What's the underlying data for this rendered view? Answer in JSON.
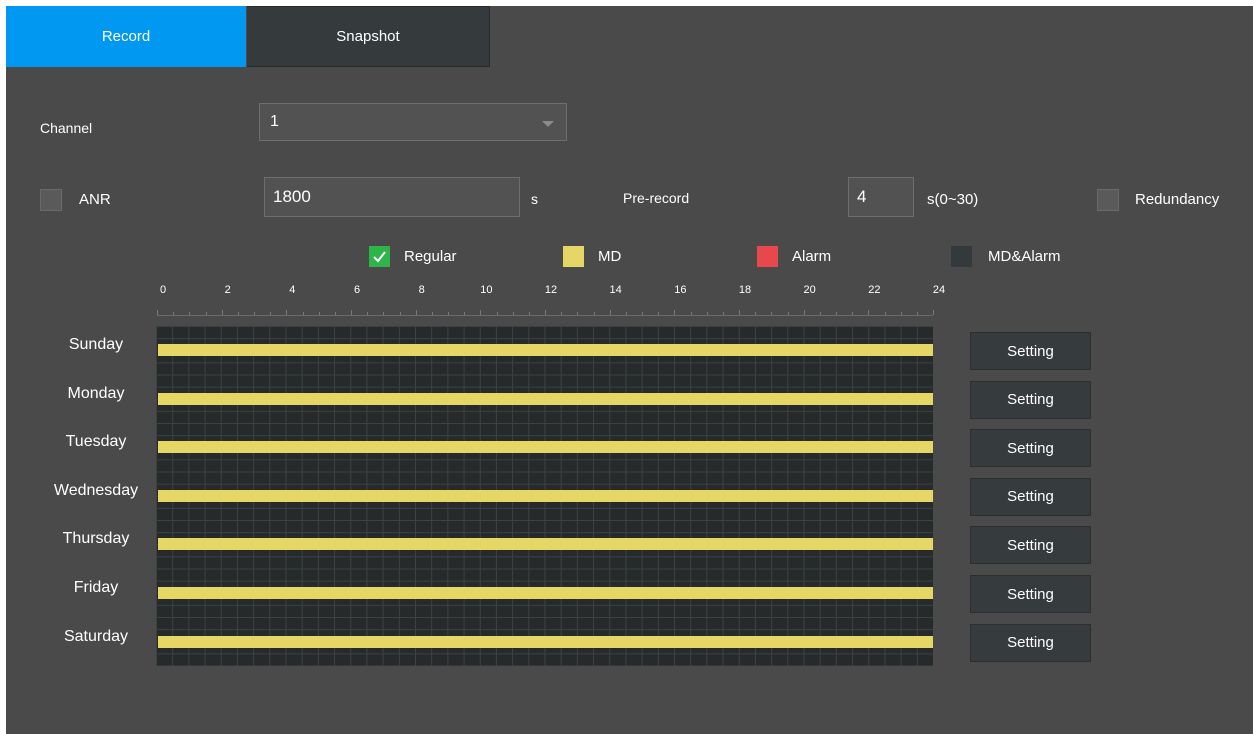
{
  "tabs": {
    "record": "Record",
    "snapshot": "Snapshot"
  },
  "channel": {
    "label": "Channel",
    "value": "1"
  },
  "anr": {
    "label": "ANR",
    "value": "1800",
    "unit": "s"
  },
  "prerecord": {
    "label": "Pre-record",
    "value": "4",
    "unit": "s(0~30)"
  },
  "redundancy": {
    "label": "Redundancy"
  },
  "legend": {
    "regular": {
      "label": "Regular",
      "color": "#2db54a",
      "checked": true
    },
    "md": {
      "label": "MD",
      "color": "#e6d666"
    },
    "alarm": {
      "label": "Alarm",
      "color": "#e8484b"
    },
    "md_alarm": {
      "label": "MD&Alarm",
      "color": "#333a3b"
    }
  },
  "timeline": {
    "ticks": [
      "0",
      "2",
      "4",
      "6",
      "8",
      "10",
      "12",
      "14",
      "16",
      "18",
      "20",
      "22",
      "24"
    ],
    "range_hours": [
      0,
      24
    ]
  },
  "schedule": [
    {
      "day": "Sunday",
      "type": "MD",
      "start": 0,
      "end": 24,
      "button": "Setting"
    },
    {
      "day": "Monday",
      "type": "MD",
      "start": 0,
      "end": 24,
      "button": "Setting"
    },
    {
      "day": "Tuesday",
      "type": "MD",
      "start": 0,
      "end": 24,
      "button": "Setting"
    },
    {
      "day": "Wednesday",
      "type": "MD",
      "start": 0,
      "end": 24,
      "button": "Setting"
    },
    {
      "day": "Thursday",
      "type": "MD",
      "start": 0,
      "end": 24,
      "button": "Setting"
    },
    {
      "day": "Friday",
      "type": "MD",
      "start": 0,
      "end": 24,
      "button": "Setting"
    },
    {
      "day": "Saturday",
      "type": "MD",
      "start": 0,
      "end": 24,
      "button": "Setting"
    }
  ]
}
